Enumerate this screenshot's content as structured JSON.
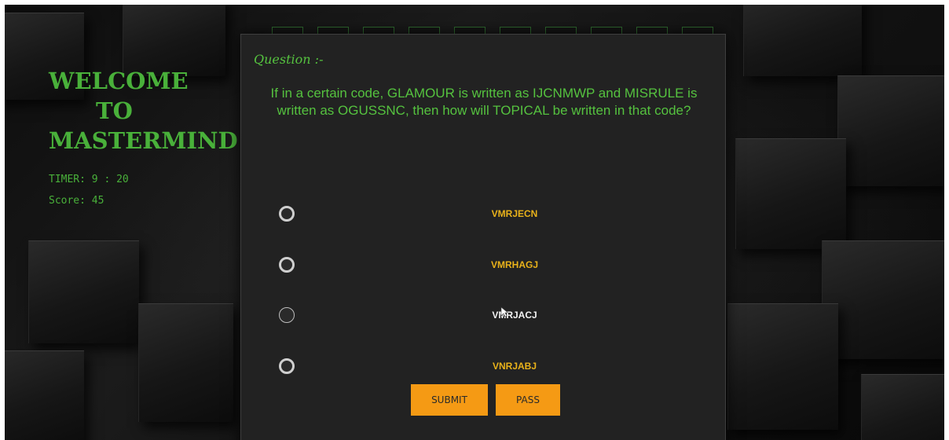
{
  "sidebar": {
    "welcome_line1": "WELCOME",
    "welcome_line2": "TO",
    "welcome_line3": "MASTERMIND",
    "timer": "TIMER: 9 : 20",
    "score": "Score: 45"
  },
  "question": {
    "heading": "Question :-",
    "text": "If in a certain code, GLAMOUR is written as IJCNMWP and MISRULE is written as OGUSSNC, then how will TOPICAL be written in that code?"
  },
  "options": [
    {
      "label": "VMRJECN"
    },
    {
      "label": "VMRHAGJ"
    },
    {
      "label": "VMRJACJ"
    },
    {
      "label": "VNRJABJ"
    }
  ],
  "buttons": {
    "submit": "SUBMIT",
    "pass": "PASS"
  },
  "colors": {
    "accent_green": "#49b03a",
    "option_yellow": "#e9b21a",
    "button_orange": "#f59a14",
    "panel_bg": "#222222"
  }
}
